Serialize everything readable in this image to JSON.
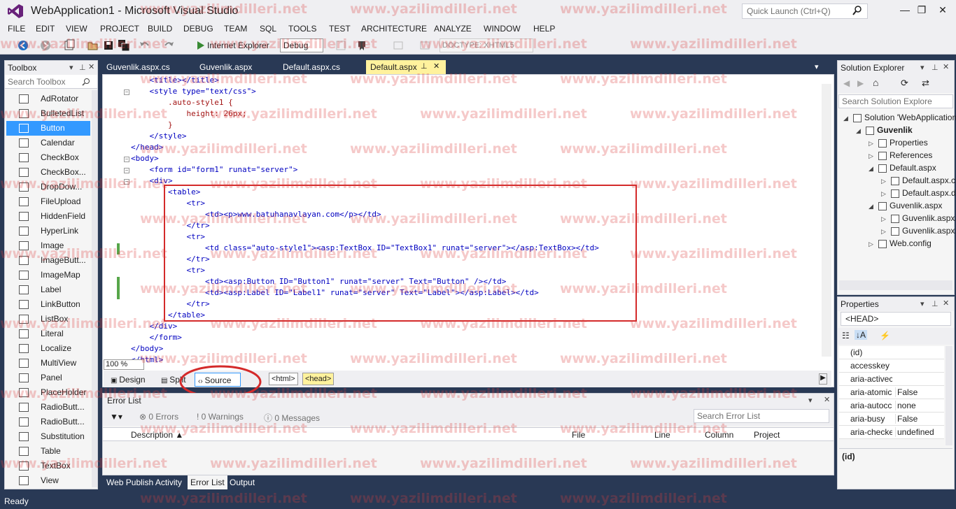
{
  "window": {
    "title": "WebApplication1 - Microsoft Visual Studio",
    "quick_launch_placeholder": "Quick Launch (Ctrl+Q)",
    "minimize": "—",
    "maximize": "❐",
    "close": "✕"
  },
  "menu": [
    "FILE",
    "EDIT",
    "VIEW",
    "PROJECT",
    "BUILD",
    "DEBUG",
    "TEAM",
    "SQL",
    "TOOLS",
    "TEST",
    "ARCHITECTURE",
    "ANALYZE",
    "WINDOW",
    "HELP"
  ],
  "toolbar": {
    "browser": "Internet Explorer",
    "configuration": "Debug",
    "doctype": "DOCTYPE: XHTML5"
  },
  "toolbox": {
    "title": "Toolbox",
    "search_placeholder": "Search Toolbox",
    "items": [
      "AdRotator",
      "BulletedList",
      "Button",
      "Calendar",
      "CheckBox",
      "CheckBox...",
      "DropDow...",
      "FileUpload",
      "HiddenField",
      "HyperLink",
      "Image",
      "ImageButt...",
      "ImageMap",
      "Label",
      "LinkButton",
      "ListBox",
      "Literal",
      "Localize",
      "MultiView",
      "Panel",
      "PlaceHolder",
      "RadioButt...",
      "RadioButt...",
      "Substitution",
      "Table",
      "TextBox",
      "View"
    ],
    "selected": "Button"
  },
  "doc_tabs": [
    {
      "label": "Guvenlik.aspx.cs"
    },
    {
      "label": "Guvenlik.aspx"
    },
    {
      "label": "Default.aspx.cs"
    },
    {
      "label": "Default.aspx",
      "active": true
    }
  ],
  "code_lines": [
    "    <title></title>",
    "    <style type=\"text/css\">",
    "        .auto-style1 {",
    "            height: 26px;",
    "        }",
    "    </style>",
    "</head>",
    "<body>",
    "    <form id=\"form1\" runat=\"server\">",
    "    <div>",
    "        <table>",
    "            <tr>",
    "                <td><p>www.batuhanavlayan.com</p></td>",
    "            </tr>",
    "            <tr>",
    "                <td class=\"auto-style1\"><asp:TextBox ID=\"TextBox1\" runat=\"server\"></asp:TextBox></td>",
    "            </tr>",
    "            <tr>",
    "                <td><asp:Button ID=\"Button1\" runat=\"server\" Text=\"Button\" /></td>",
    "                <td><asp:Label ID=\"Label1\" runat=\"server\" Text=\"Label\"></asp:Label></td>",
    "            </tr>",
    "        </table>",
    "    </div>",
    "    </form>",
    "</body>",
    "</html>"
  ],
  "zoom": "100 %",
  "view_bar": {
    "design": "Design",
    "split": "Split",
    "source": "Source",
    "crumbs": [
      "<html>",
      "<head>"
    ]
  },
  "error_list": {
    "title": "Error List",
    "errors": "0 Errors",
    "warnings": "0 Warnings",
    "messages": "0 Messages",
    "search_placeholder": "Search Error List",
    "columns": [
      "Description",
      "File",
      "Line",
      "Column",
      "Project"
    ]
  },
  "bottom_tabs": [
    {
      "label": "Web Publish Activity"
    },
    {
      "label": "Error List",
      "active": true
    },
    {
      "label": "Output"
    }
  ],
  "solution_explorer": {
    "title": "Solution Explorer",
    "search_placeholder": "Search Solution Explore",
    "nodes": [
      {
        "label": "Solution 'WebApplication",
        "depth": 0
      },
      {
        "label": "Guvenlik",
        "depth": 1,
        "bold": true
      },
      {
        "label": "Properties",
        "depth": 2
      },
      {
        "label": "References",
        "depth": 2
      },
      {
        "label": "Default.aspx",
        "depth": 2
      },
      {
        "label": "Default.aspx.cs",
        "depth": 3
      },
      {
        "label": "Default.aspx.de",
        "depth": 3
      },
      {
        "label": "Guvenlik.aspx",
        "depth": 2
      },
      {
        "label": "Guvenlik.aspx.",
        "depth": 3
      },
      {
        "label": "Guvenlik.aspx.",
        "depth": 3
      },
      {
        "label": "Web.config",
        "depth": 2
      }
    ]
  },
  "properties": {
    "title": "Properties",
    "object": "<HEAD>",
    "rows": [
      {
        "name": "(id)",
        "value": ""
      },
      {
        "name": "accesskey",
        "value": ""
      },
      {
        "name": "aria-activec",
        "value": ""
      },
      {
        "name": "aria-atomic",
        "value": "False"
      },
      {
        "name": "aria-autocc",
        "value": "none"
      },
      {
        "name": "aria-busy",
        "value": "False"
      },
      {
        "name": "aria-checke",
        "value": "undefined"
      }
    ],
    "description": "(id)"
  },
  "status": "Ready",
  "watermark": "www.yazilimdilleri.net",
  "colors": {
    "accent": "#3399FF",
    "frame": "#293955",
    "annotation": "#D42A2A",
    "active_tab": "#FFF29D"
  }
}
